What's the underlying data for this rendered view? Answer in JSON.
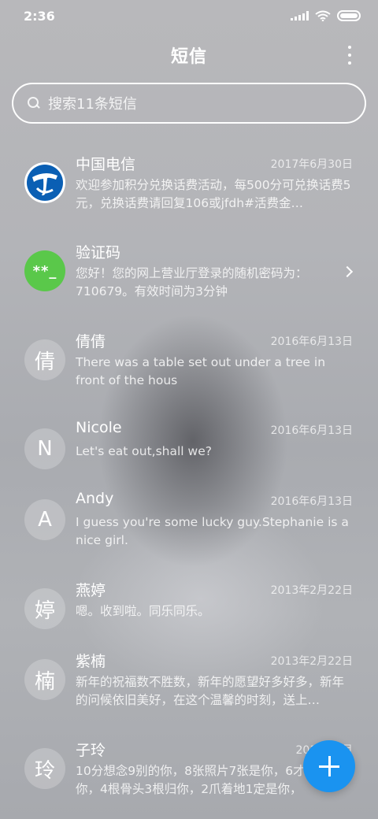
{
  "status_bar": {
    "time": "2:36",
    "icons": [
      "signal-icon",
      "wifi-icon",
      "battery-icon"
    ]
  },
  "header": {
    "title": "短信",
    "menu_icon": "more-vertical-icon"
  },
  "search": {
    "placeholder": "搜索11条短信",
    "icon": "search-icon"
  },
  "conversations": [
    {
      "name": "中国电信",
      "date": "2017年6月30日",
      "preview": "欢迎参加积分兑换话费活动，每500分可兑换话费5元，兑换话费请回复106或jfdh#活费金…",
      "avatar": "telecom-logo"
    },
    {
      "name": "验证码",
      "date": "",
      "preview": "您好！您的网上营业厅登录的随机密码为：710679。有效时间为3分钟",
      "avatar_text": "**_"
    },
    {
      "name": "倩倩",
      "date": "2016年6月13日",
      "preview": "There was a table set out under a tree in front of the hous",
      "avatar_text": "倩"
    },
    {
      "name": "Nicole",
      "date": "2016年6月13日",
      "preview": "Let's eat out,shall we?",
      "avatar_text": "N"
    },
    {
      "name": "Andy",
      "date": "2016年6月13日",
      "preview": "I guess you're some lucky guy.Stephanie is a nice girl.",
      "avatar_text": "A"
    },
    {
      "name": "燕婷",
      "date": "2013年2月22日",
      "preview": "嗯。收到啦。同乐同乐。",
      "avatar_text": "婷"
    },
    {
      "name": "紫楠",
      "date": "2013年2月22日",
      "preview": "新年的祝福数不胜数，新年的愿望好多好多，新年的问候依旧美好，在这个温馨的时刻，送上…",
      "avatar_text": "楠"
    },
    {
      "name": "子玲",
      "date": "2013年2月",
      "preview": "10分想念9别的你，8张照片7张是你，6才只像你，4根骨头3根归你，2爪着地1定是你，",
      "avatar_text": "玲"
    }
  ],
  "fab": {
    "icon": "plus-icon",
    "color": "#1a93f0"
  },
  "colors": {
    "accent": "#1a93f0",
    "verify_avatar": "#5ac84a",
    "telecom_blue": "#0a5fb4"
  }
}
